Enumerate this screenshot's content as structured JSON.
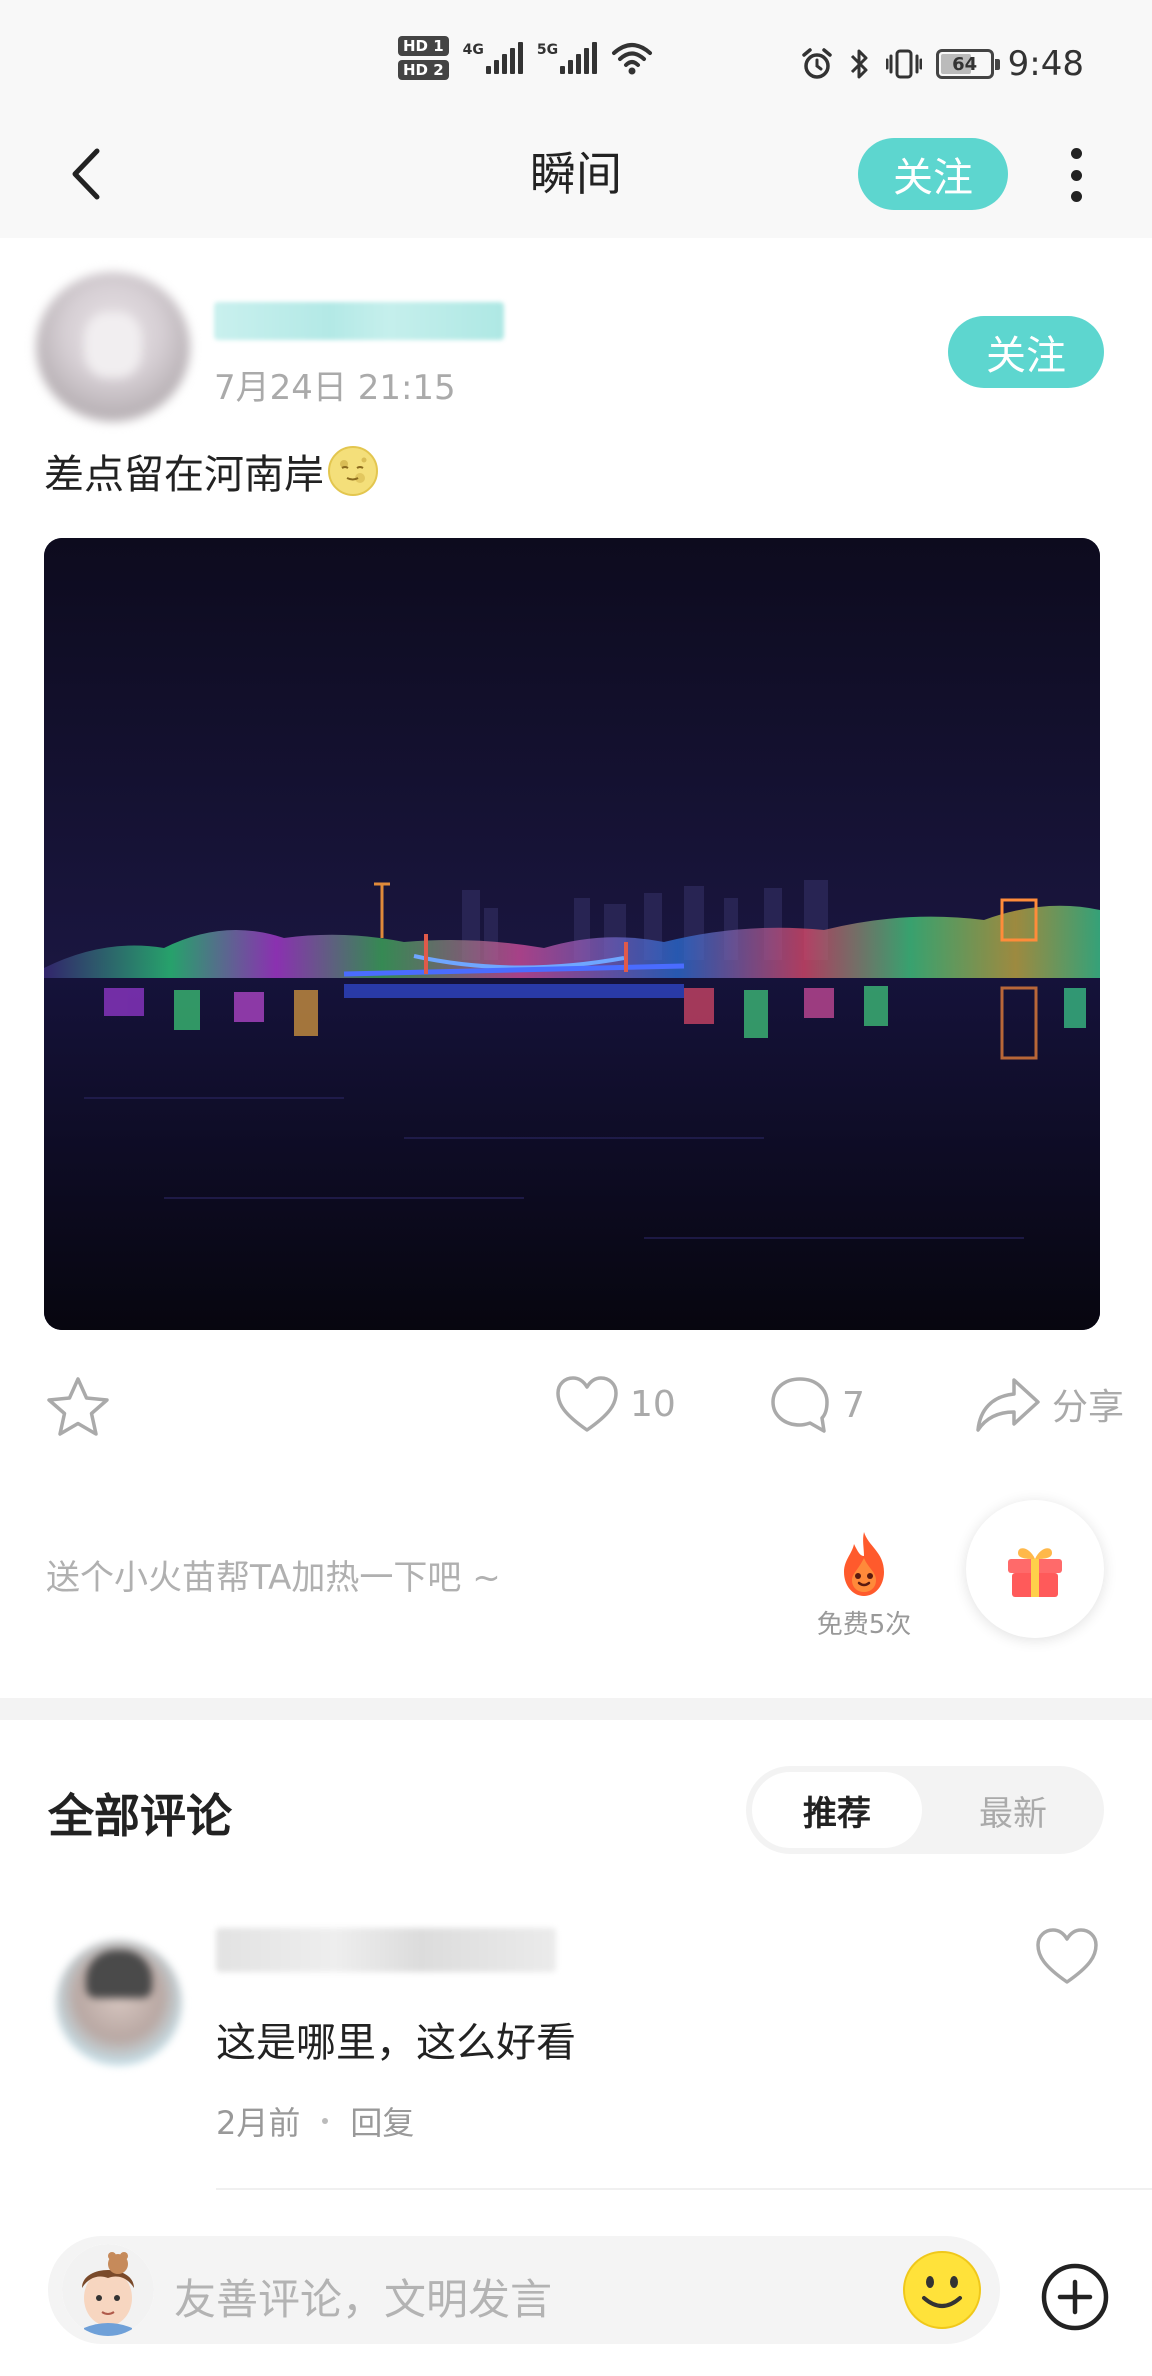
{
  "status_bar": {
    "hd1": "HD 1",
    "hd2": "HD 2",
    "net1": "4G",
    "net2": "5G",
    "battery": "64",
    "time": "9:48",
    "icons": [
      "alarm-icon",
      "bluetooth-icon",
      "vibrate-icon",
      "wifi-icon",
      "battery-icon"
    ]
  },
  "nav": {
    "title": "瞬间",
    "follow_label": "关注",
    "icons": [
      "back-icon",
      "more-icon"
    ]
  },
  "post": {
    "time": "7月24日 21:15",
    "follow_label": "关注",
    "text": "差点留在河南岸",
    "emoji": "moon-face-emoji",
    "accent_color": "#5dd6cf"
  },
  "actions": {
    "likes": "10",
    "comments": "7",
    "share_label": "分享",
    "icons": [
      "star-icon",
      "heart-icon",
      "comment-icon",
      "share-icon"
    ]
  },
  "boost": {
    "hint": "送个小火苗帮TA加热一下吧 ~",
    "flame_label": "免费5次",
    "icons": [
      "flame-icon",
      "gift-icon"
    ]
  },
  "comments": {
    "title": "全部评论",
    "sort_options": [
      "推荐",
      "最新"
    ],
    "selected_sort": "推荐",
    "items": [
      {
        "text": "这是哪里，这么好看",
        "time": "2月前",
        "reply_label": "回复"
      }
    ]
  },
  "composer": {
    "placeholder": "友善评论，文明发言",
    "icons": [
      "emoji-icon",
      "plus-circle-icon"
    ]
  }
}
